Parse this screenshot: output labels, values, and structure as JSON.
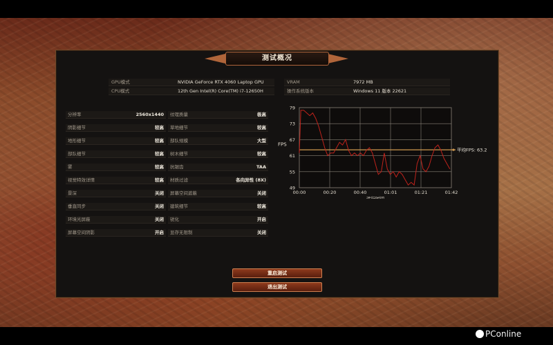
{
  "title": "测试概况",
  "system_info": [
    {
      "label": "GPU模式",
      "value": "NVIDIA GeForce RTX 4060 Laptop GPU"
    },
    {
      "label": "CPU模式",
      "value": "12th Gen Intel(R) Core(TM) i7-12650H"
    },
    {
      "label": "VRAM",
      "value": "7972 MB"
    },
    {
      "label": "操作系统版本",
      "value": "Windows 11 版本 22621"
    }
  ],
  "settings_left": [
    {
      "label": "分辨率",
      "value": "2560x1440"
    },
    {
      "label": "阴影细节",
      "value": "较高"
    },
    {
      "label": "地形细节",
      "value": "较高"
    },
    {
      "label": "部队细节",
      "value": "较高"
    },
    {
      "label": "雾",
      "value": "较高"
    },
    {
      "label": "视觉特效详情",
      "value": "较高"
    },
    {
      "label": "景深",
      "value": "关闭"
    },
    {
      "label": "垂直同步",
      "value": "关闭"
    },
    {
      "label": "环境光屏蔽",
      "value": "关闭"
    },
    {
      "label": "屏幕空间阴影",
      "value": "开启"
    }
  ],
  "settings_right": [
    {
      "label": "纹理质量",
      "value": "极高"
    },
    {
      "label": "草地细节",
      "value": "较高"
    },
    {
      "label": "部队规模",
      "value": "大型"
    },
    {
      "label": "树木细节",
      "value": "较高"
    },
    {
      "label": "抗锯齿",
      "value": "TAA"
    },
    {
      "label": "材质过滤",
      "value": "各向异性 (8X)"
    },
    {
      "label": "屏幕空间遮蔽",
      "value": "关闭"
    },
    {
      "label": "建筑细节",
      "value": "较高"
    },
    {
      "label": "锐化",
      "value": "开启"
    },
    {
      "label": "显存无限制",
      "value": "关闭"
    }
  ],
  "chart_data": {
    "type": "line",
    "ylabel": "FPS",
    "xlabel": "运行时间",
    "y_ticks": [
      "79",
      "73",
      "67",
      "61",
      "55",
      "49"
    ],
    "x_ticks": [
      "00:00",
      "00:20",
      "00:40",
      "01:01",
      "01:21",
      "01:42"
    ],
    "ylim": [
      49,
      79
    ],
    "xlim": [
      0,
      102
    ],
    "average_label": "平均FPS: 63.2",
    "average": 63.2,
    "line_color": "#c0231c",
    "average_color": "#d09a50",
    "x": [
      0,
      1,
      3,
      5,
      7,
      9,
      11,
      13,
      15,
      17,
      19,
      21,
      23,
      25,
      27,
      29,
      31,
      33,
      35,
      37,
      39,
      41,
      43,
      45,
      47,
      49,
      51,
      53,
      55,
      57,
      59,
      61,
      63,
      65,
      67,
      69,
      71,
      73,
      75,
      77,
      79,
      81,
      83,
      85,
      87,
      89,
      91,
      93,
      95,
      97,
      99,
      101
    ],
    "y": [
      62,
      78,
      78,
      77,
      76,
      77,
      75,
      72,
      68,
      64,
      61,
      62,
      62,
      64,
      66,
      65,
      67,
      63,
      61,
      62,
      61,
      62,
      61,
      63,
      64,
      62,
      58,
      54,
      55,
      62,
      56,
      54,
      55,
      53,
      55,
      54,
      52,
      50,
      51,
      50,
      58,
      61,
      56,
      55,
      57,
      61,
      64,
      65,
      63,
      60,
      58,
      56
    ]
  },
  "buttons": {
    "restart": "重启测试",
    "exit": "退出测试"
  },
  "watermark": "PConline"
}
